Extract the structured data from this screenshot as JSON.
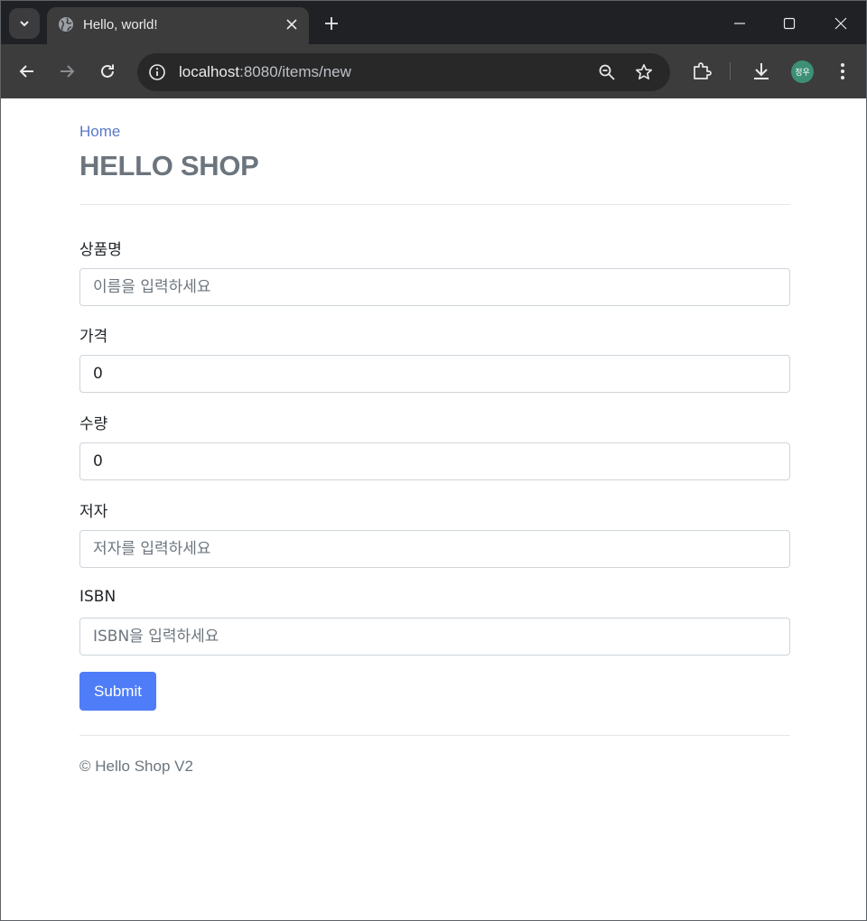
{
  "browser": {
    "tab": {
      "title": "Hello, world!"
    },
    "omnibox": {
      "host": "localhost",
      "path": ":8080/items/new"
    },
    "profile": {
      "initials": "정우"
    },
    "icons": [
      "tab-search-icon",
      "globe-icon",
      "close-icon",
      "plus-icon",
      "minimize-icon",
      "maximize-icon",
      "back-icon",
      "forward-icon",
      "reload-icon",
      "info-icon",
      "zoom-icon",
      "star-icon",
      "extensions-icon",
      "download-icon",
      "kebab-menu-icon"
    ]
  },
  "page": {
    "home_link": "Home",
    "title": "HELLO SHOP",
    "form": {
      "name": {
        "label": "상품명",
        "placeholder": "이름을 입력하세요",
        "value": ""
      },
      "price": {
        "label": "가격",
        "value": "0"
      },
      "stock": {
        "label": "수량",
        "value": "0"
      },
      "author": {
        "label": "저자",
        "placeholder": "저자를 입력하세요",
        "value": ""
      },
      "isbn": {
        "label": "ISBN",
        "placeholder": "ISBN을 입력하세요",
        "value": ""
      },
      "submit_label": "Submit"
    },
    "footer": "© Hello Shop V2"
  },
  "colors": {
    "primary_button": "#4f7df7",
    "link": "#5a78c8",
    "muted_text": "#6c757d"
  }
}
